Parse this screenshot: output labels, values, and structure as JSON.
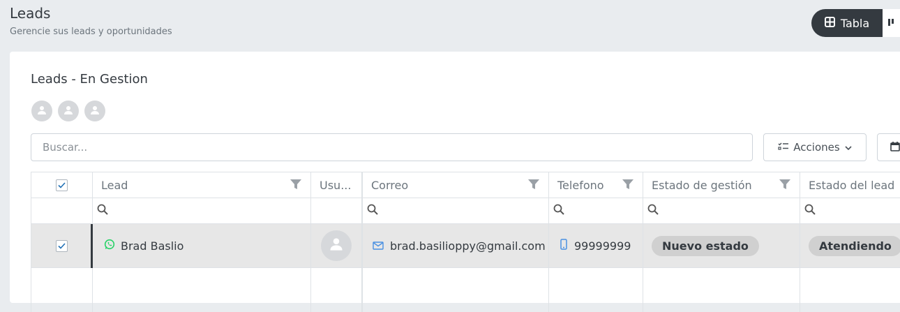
{
  "header": {
    "title": "Leads",
    "subtitle": "Gerencie sus leads y oportunidades"
  },
  "view_toggle": {
    "table_label": "Tabla",
    "active": "Tabla"
  },
  "card": {
    "title": "Leads - En Gestion",
    "avatar_count": 3
  },
  "toolbar": {
    "search_placeholder": "Buscar...",
    "actions_label": "Acciones"
  },
  "table": {
    "columns": [
      {
        "key": "lead",
        "label": "Lead"
      },
      {
        "key": "usuario",
        "label": "Usu..."
      },
      {
        "key": "correo",
        "label": "Correo"
      },
      {
        "key": "telefono",
        "label": "Telefono"
      },
      {
        "key": "estado_gestion",
        "label": "Estado de gestión"
      },
      {
        "key": "estado_lead",
        "label": "Estado del lead"
      }
    ],
    "rows": [
      {
        "selected": true,
        "lead": "Brad Baslio",
        "lead_channel_icon": "whatsapp-icon",
        "correo": "brad.basilioppy@gmail.com",
        "telefono": "99999999",
        "estado_gestion": "Nuevo estado",
        "estado_lead": "Atendiendo"
      }
    ]
  },
  "colors": {
    "dark": "#343a40",
    "whatsapp": "#25d366",
    "email": "#4a90e2",
    "phone": "#4a90e2",
    "selected_row": "#e7e7e7"
  }
}
